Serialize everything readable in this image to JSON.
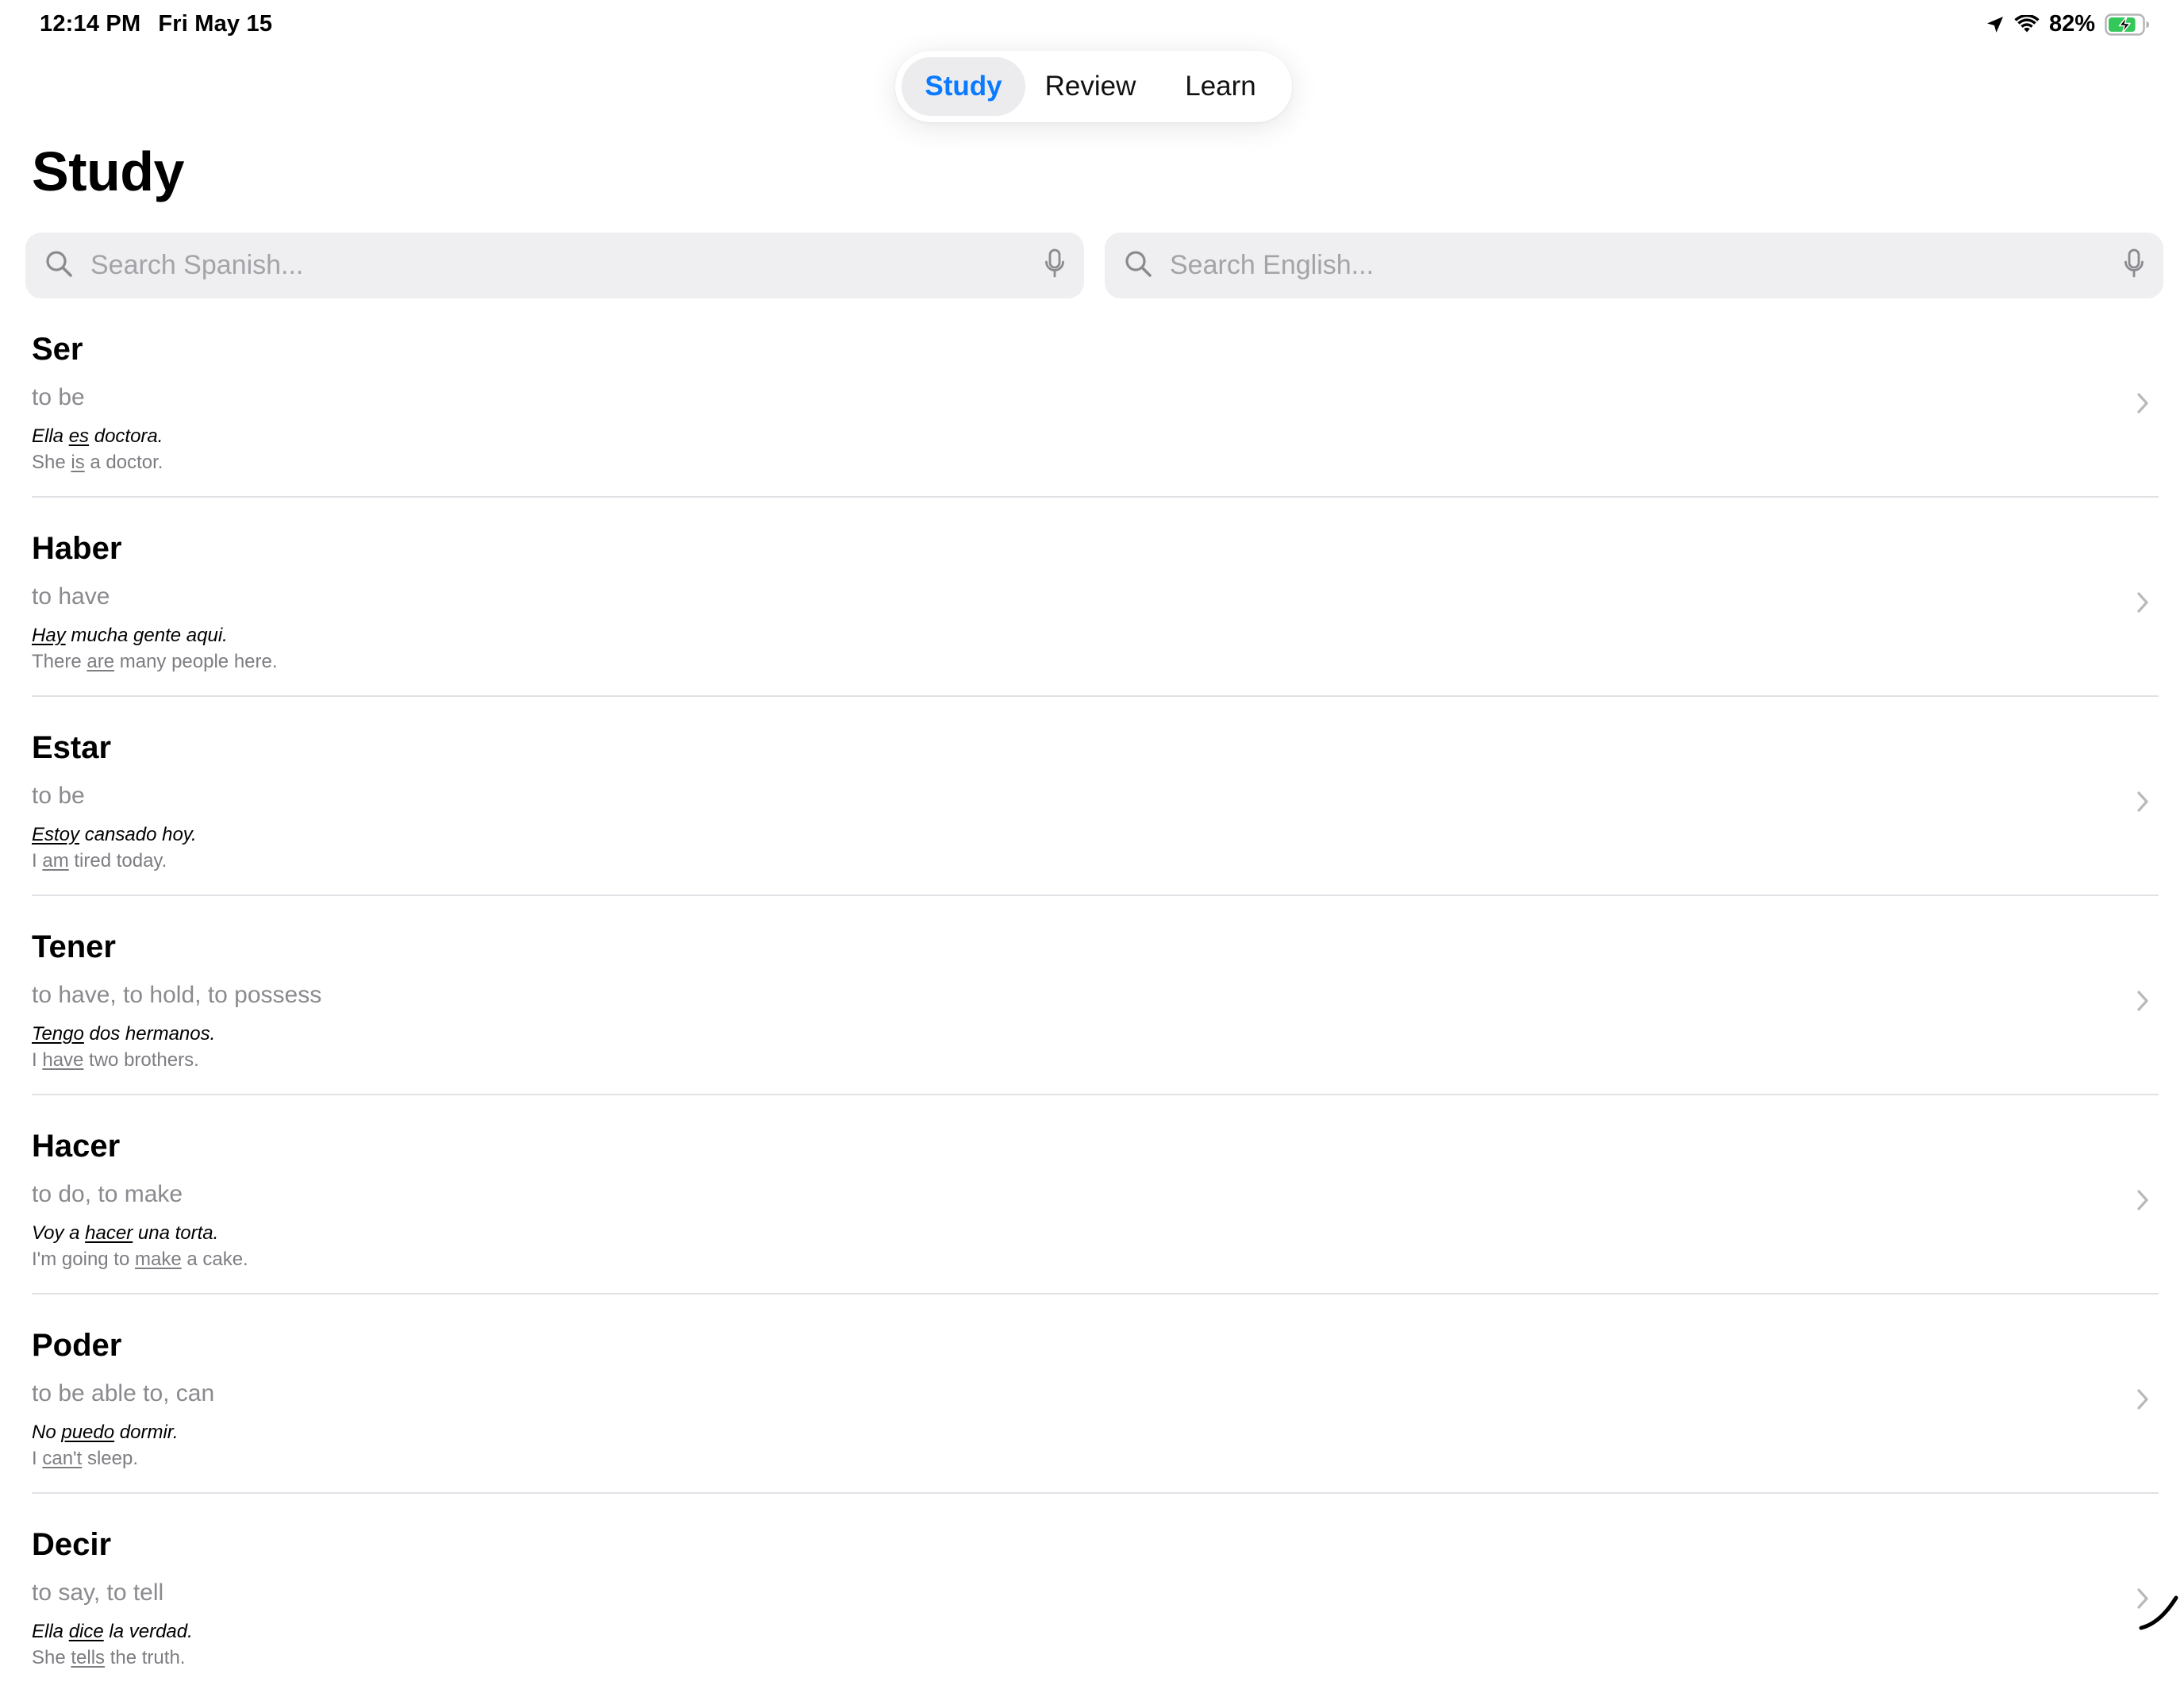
{
  "status_bar": {
    "time": "12:14 PM",
    "date": "Fri May 15",
    "battery_percent": "82%",
    "battery_level": 0.82,
    "charging": true
  },
  "tabs": [
    {
      "label": "Study",
      "active": true
    },
    {
      "label": "Review",
      "active": false
    },
    {
      "label": "Learn",
      "active": false
    }
  ],
  "page_title": "Study",
  "search": {
    "spanish_placeholder": "Search Spanish...",
    "english_placeholder": "Search English...",
    "spanish_value": "",
    "english_value": ""
  },
  "colors": {
    "accent": "#0a7aff",
    "secondary_text": "#8a8a8f",
    "search_bg": "#efeff1"
  },
  "icons": [
    "location-arrow-icon",
    "wifi-icon",
    "battery-charging-icon",
    "search-icon",
    "microphone-icon",
    "chevron-right-icon"
  ],
  "verbs": [
    {
      "word": "Ser",
      "meaning": "to be",
      "example_es": {
        "pre": "Ella ",
        "hl": "es",
        "post": " doctora."
      },
      "example_en": {
        "pre": "She ",
        "hl": "is",
        "post": " a doctor."
      }
    },
    {
      "word": "Haber",
      "meaning": "to have",
      "example_es": {
        "pre": "",
        "hl": "Hay",
        "post": " mucha gente aqui."
      },
      "example_en": {
        "pre": "There ",
        "hl": "are",
        "post": " many people here."
      }
    },
    {
      "word": "Estar",
      "meaning": "to be",
      "example_es": {
        "pre": "",
        "hl": "Estoy",
        "post": " cansado hoy."
      },
      "example_en": {
        "pre": "I ",
        "hl": "am",
        "post": " tired today."
      }
    },
    {
      "word": "Tener",
      "meaning": "to have, to hold, to possess",
      "example_es": {
        "pre": "",
        "hl": "Tengo",
        "post": " dos hermanos."
      },
      "example_en": {
        "pre": "I ",
        "hl": "have",
        "post": " two brothers."
      }
    },
    {
      "word": "Hacer",
      "meaning": "to do, to make",
      "example_es": {
        "pre": "Voy a ",
        "hl": "hacer",
        "post": " una torta."
      },
      "example_en": {
        "pre": "I'm going to ",
        "hl": "make",
        "post": " a cake."
      }
    },
    {
      "word": "Poder",
      "meaning": "to be able to, can",
      "example_es": {
        "pre": "No ",
        "hl": "puedo",
        "post": " dormir."
      },
      "example_en": {
        "pre": "I ",
        "hl": "can't",
        "post": " sleep."
      }
    },
    {
      "word": "Decir",
      "meaning": "to say, to tell",
      "example_es": {
        "pre": "Ella ",
        "hl": "dice",
        "post": " la verdad."
      },
      "example_en": {
        "pre": "She ",
        "hl": "tells",
        "post": " the truth."
      }
    }
  ]
}
